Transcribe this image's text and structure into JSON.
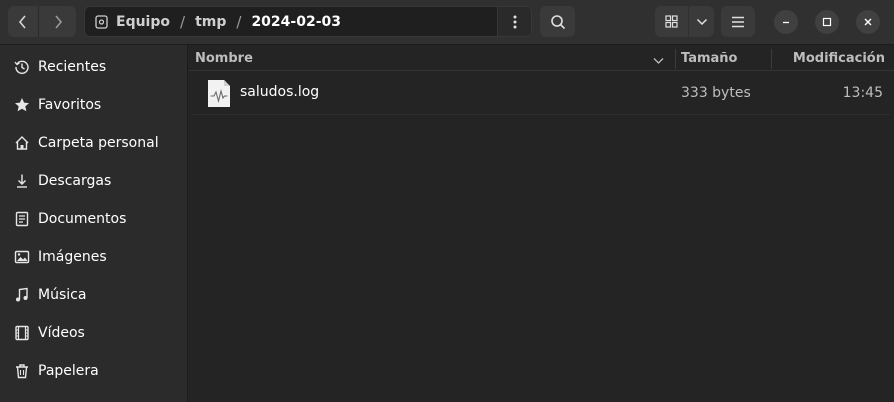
{
  "path": {
    "crumbs": [
      "Equipo",
      "tmp",
      "2024-02-03"
    ],
    "separator": "/"
  },
  "sidebar": {
    "items": [
      {
        "label": "Recientes",
        "icon": "clock-icon"
      },
      {
        "label": "Favoritos",
        "icon": "star-icon"
      },
      {
        "label": "Carpeta personal",
        "icon": "home-icon"
      },
      {
        "label": "Descargas",
        "icon": "download-icon"
      },
      {
        "label": "Documentos",
        "icon": "document-icon"
      },
      {
        "label": "Imágenes",
        "icon": "image-icon"
      },
      {
        "label": "Música",
        "icon": "music-icon"
      },
      {
        "label": "Vídeos",
        "icon": "video-icon"
      },
      {
        "label": "Papelera",
        "icon": "trash-icon"
      }
    ]
  },
  "columns": {
    "name": "Nombre",
    "size": "Tamaño",
    "modified": "Modificación"
  },
  "files": [
    {
      "name": "saludos.log",
      "size": "333 bytes",
      "modified": "13:45",
      "icon": "log-file-icon"
    }
  ],
  "colors": {
    "window_bg": "#242424",
    "headerbar_bg": "#303030",
    "sidebar_bg": "#2b2b2b",
    "button_bg": "#3a3a3a"
  }
}
